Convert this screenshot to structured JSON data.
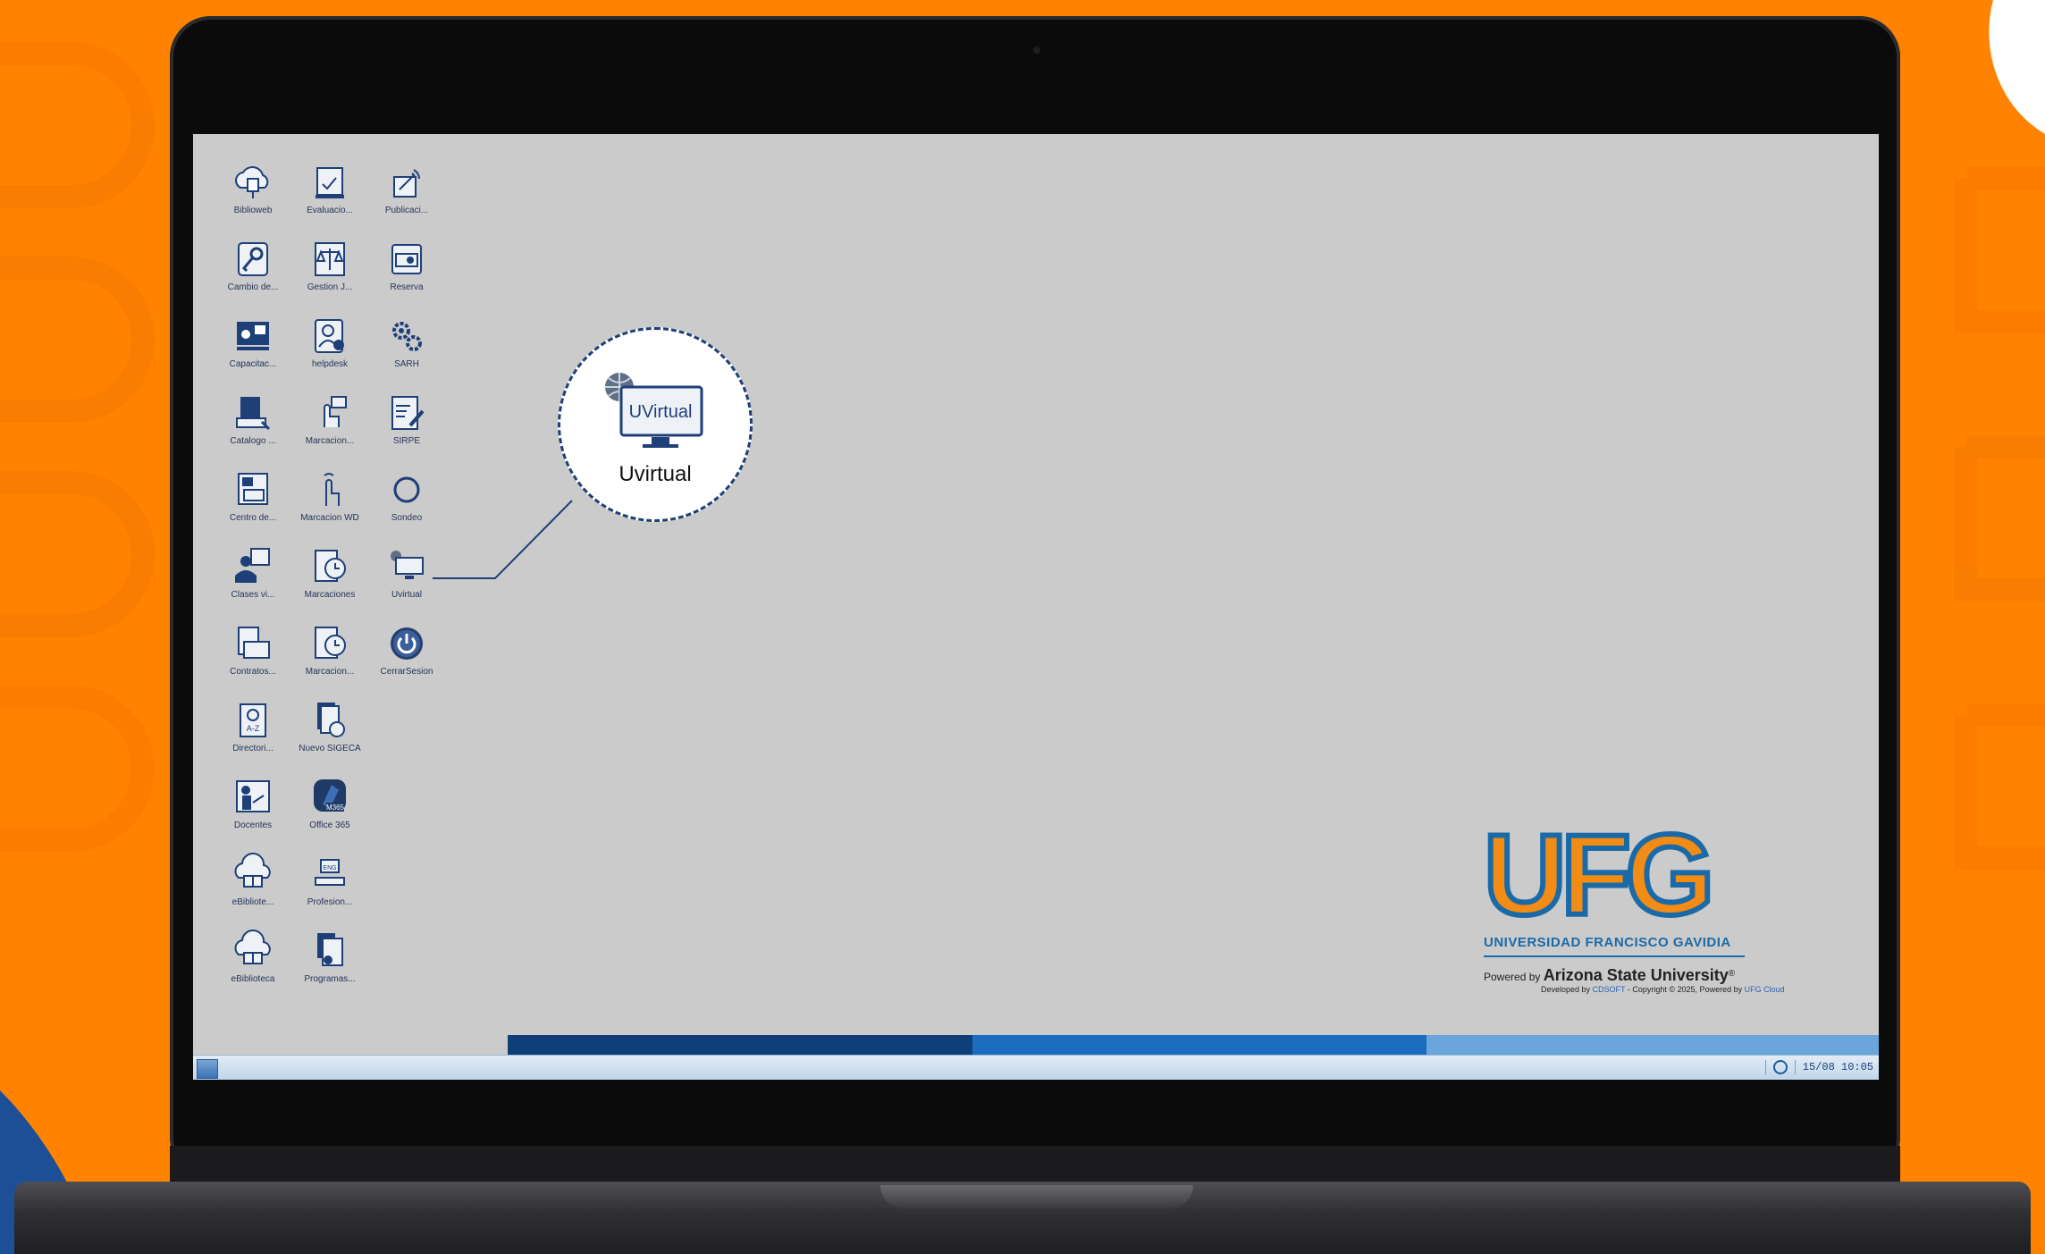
{
  "desktop_icons": [
    {
      "label": "Biblioweb",
      "icon": "cloud-book-icon"
    },
    {
      "label": "Evaluacio...",
      "icon": "evaluation-icon"
    },
    {
      "label": "Publicaci...",
      "icon": "publication-icon"
    },
    {
      "label": "Cambio de...",
      "icon": "key-icon"
    },
    {
      "label": "Gestion J...",
      "icon": "scales-icon"
    },
    {
      "label": "Reserva",
      "icon": "projector-icon"
    },
    {
      "label": "Capacitac...",
      "icon": "training-icon"
    },
    {
      "label": "helpdesk",
      "icon": "helpdesk-icon"
    },
    {
      "label": "SARH",
      "icon": "gears-icon"
    },
    {
      "label": "Catalogo ...",
      "icon": "catalog-icon"
    },
    {
      "label": "Marcacion...",
      "icon": "touch-icon"
    },
    {
      "label": "SIRPE",
      "icon": "document-pen-icon"
    },
    {
      "label": "Centro de...",
      "icon": "center-icon"
    },
    {
      "label": "Marcacion WD",
      "icon": "finger-icon"
    },
    {
      "label": "Sondeo",
      "icon": "circle-icon"
    },
    {
      "label": "Clases vi...",
      "icon": "virtual-class-icon"
    },
    {
      "label": "Marcaciones",
      "icon": "clock-list-icon"
    },
    {
      "label": "Uvirtual",
      "icon": "uvirtual-icon"
    },
    {
      "label": "Contratos...",
      "icon": "contracts-icon"
    },
    {
      "label": "Marcacion...",
      "icon": "clock-list-icon"
    },
    {
      "label": "CerrarSesion",
      "icon": "power-icon"
    },
    {
      "label": "Directori...",
      "icon": "directory-icon"
    },
    {
      "label": "Nuevo SIGECA",
      "icon": "files-clock-icon"
    },
    {
      "label": "Docentes",
      "icon": "teacher-icon"
    },
    {
      "label": "Office 365",
      "icon": "office-icon"
    },
    {
      "label": "eBibliote...",
      "icon": "ebook-icon"
    },
    {
      "label": "Profesion...",
      "icon": "keyboard-eng-icon"
    },
    {
      "label": "eBiblioteca",
      "icon": "ebook-icon"
    },
    {
      "label": "Programas...",
      "icon": "programs-icon"
    }
  ],
  "callout": {
    "label": "Uvirtual",
    "screen_text": "UVirtual"
  },
  "logo": {
    "letters": "UFG",
    "subtitle": "UNIVERSIDAD FRANCISCO GAVIDIA",
    "powered_prefix": "Powered by ",
    "powered_name": "Arizona State University",
    "powered_mark": "®",
    "dev_prefix": "Developed by ",
    "dev_company": "CDSOFT",
    "dev_middle": " - Copyright © 2025, Powered by ",
    "dev_cloud": "UFG Cloud"
  },
  "taskbar": {
    "clock": "15/08  10:05"
  },
  "colors": {
    "background": "#ff8200",
    "desktop": "#cbcbcb",
    "icon_blue": "#1e3f78",
    "logo_orange": "#f28c14",
    "logo_blue": "#1b6aa8"
  }
}
